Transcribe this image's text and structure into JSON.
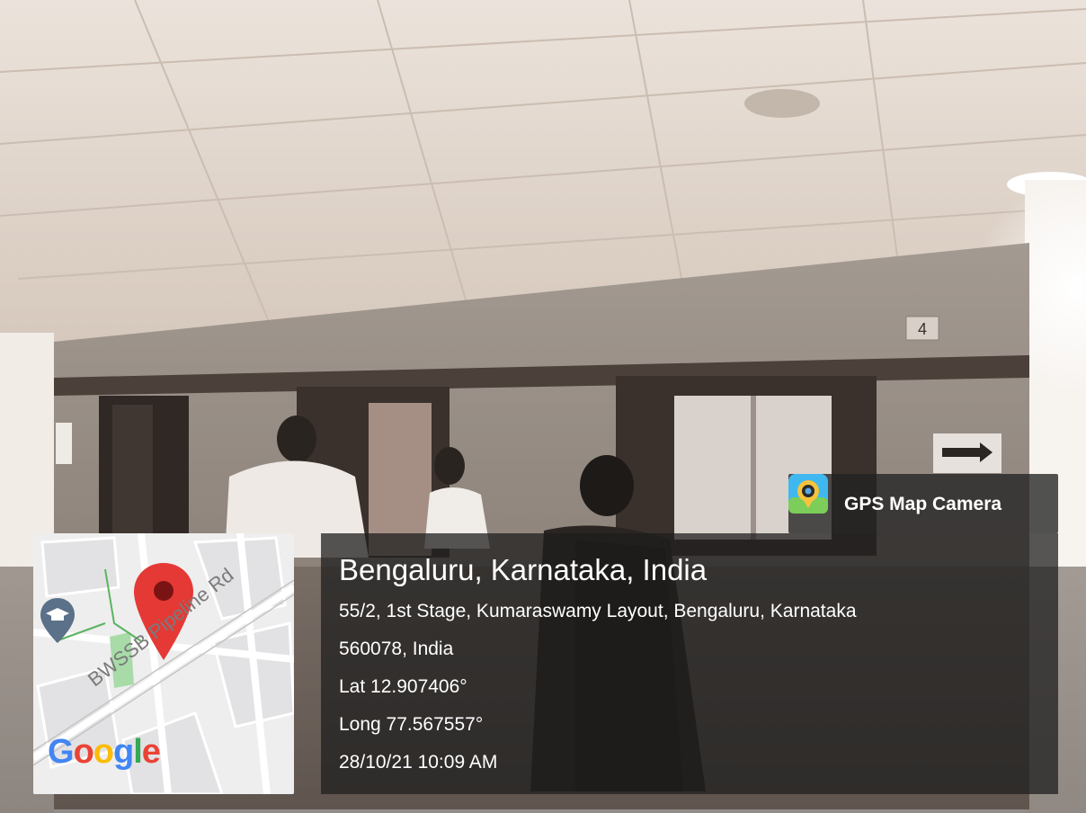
{
  "app": {
    "name": "GPS Map Camera",
    "icon": "camera-pin-icon"
  },
  "location": {
    "title": "Bengaluru, Karnataka, India",
    "address_line1": "55/2, 1st Stage, Kumaraswamy Layout, Bengaluru, Karnataka",
    "address_line2": "560078, India",
    "latitude": "Lat 12.907406°",
    "longitude": "Long 77.567557°",
    "timestamp": "28/10/21 10:09 AM"
  },
  "map": {
    "road_label": "BWSSB Pipeline Rd",
    "logo": [
      "G",
      "o",
      "o",
      "g",
      "l",
      "e"
    ],
    "logo_colors": [
      "#4285f4",
      "#ea4335",
      "#fbbc05",
      "#4285f4",
      "#34a853",
      "#ea4335"
    ],
    "pin_color": "#e53935",
    "poi_icon": "graduation-cap-icon"
  },
  "scene": {
    "floor_sign": "4"
  }
}
